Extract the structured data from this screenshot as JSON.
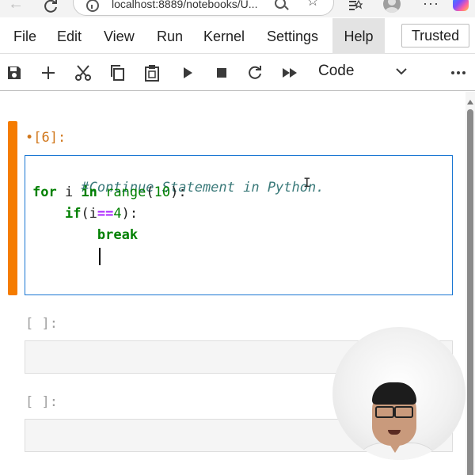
{
  "browser": {
    "address": "localhost:8889/notebooks/U..."
  },
  "menu": {
    "items": [
      "File",
      "Edit",
      "View",
      "Run",
      "Kernel",
      "Settings",
      "Help"
    ],
    "active_item": "Help",
    "trusted_label": "Trusted"
  },
  "toolbar": {
    "icons": [
      "save-icon",
      "add-icon",
      "cut-icon",
      "copy-icon",
      "paste-icon",
      "run-icon",
      "stop-icon",
      "restart-icon",
      "fast-forward-icon",
      "more-icon"
    ],
    "cell_type": "Code"
  },
  "notebook": {
    "active_cell": {
      "prompt": "•[6]:",
      "code": {
        "line1": "#Continue Statement in Python.",
        "line2_kw1": "for",
        "line2_var": " i ",
        "line2_kw2": "in",
        "line2_builtin": " range",
        "line2_p1": "(",
        "line2_num": "10",
        "line2_p2": "):",
        "line3_indent": "    ",
        "line3_kw": "if",
        "line3_p1": "(i",
        "line3_op": "==",
        "line3_num": "4",
        "line3_p2": "):",
        "line4_indent": "        ",
        "line4_kw": "break"
      }
    },
    "empty_cells": [
      {
        "prompt": "[ ]:"
      },
      {
        "prompt": "[ ]:"
      }
    ]
  },
  "colors": {
    "accent_active_cell": "#f57c00",
    "editor_border": "#1976d2",
    "keyword": "#008000",
    "comment": "#3b7a7a",
    "operator": "#aa22ff"
  }
}
